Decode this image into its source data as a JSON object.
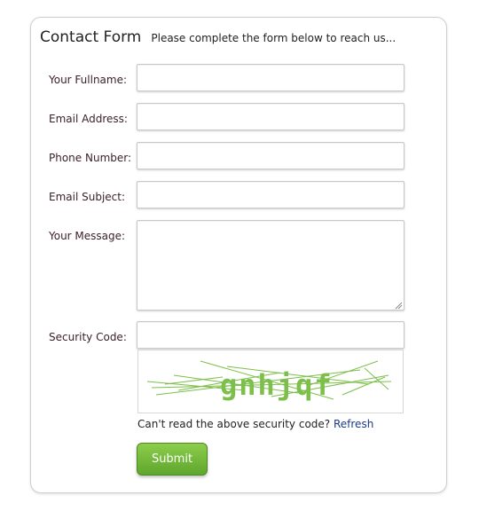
{
  "header": {
    "title": "Contact Form",
    "subtitle": "Please complete the form below to reach us..."
  },
  "fields": {
    "fullname": {
      "label": "Your Fullname:",
      "value": ""
    },
    "email": {
      "label": "Email Address:",
      "value": ""
    },
    "phone": {
      "label": "Phone Number:",
      "value": ""
    },
    "subject": {
      "label": "Email Subject:",
      "value": ""
    },
    "message": {
      "label": "Your Message:",
      "value": ""
    },
    "security": {
      "label": "Security Code:",
      "value": ""
    }
  },
  "captcha": {
    "text": "gnhjqf",
    "note": "Can't read the above security code?",
    "refresh_label": "Refresh",
    "color": "#7cbf4a"
  },
  "submit": {
    "label": "Submit"
  }
}
